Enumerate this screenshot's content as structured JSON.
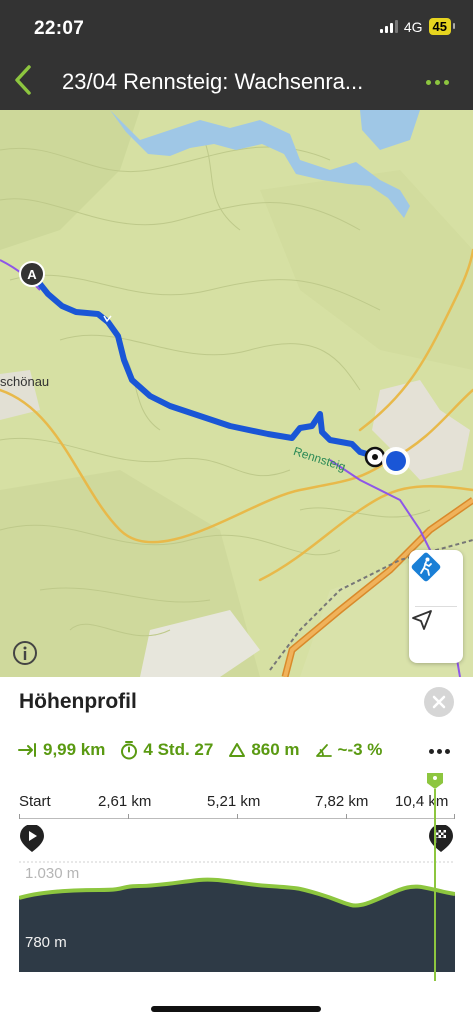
{
  "status_bar": {
    "time": "22:07",
    "network": "4G",
    "battery": "45"
  },
  "header": {
    "title": "23/04 Rennsteig: Wachsenra..."
  },
  "map": {
    "place_label": "schönau",
    "trail_label": "Rennsteig",
    "start_marker": "A",
    "route_color": "#1a56d6",
    "position_color": "#1a56d6"
  },
  "sheet": {
    "title": "Höhenprofil",
    "stats": {
      "distance": "9,99 km",
      "duration": "4 Std. 27",
      "ascent": "860 m",
      "gradient": "~-3 %"
    },
    "distance_axis": [
      "Start",
      "2,61 km",
      "5,21 km",
      "7,82 km",
      "10,4 km"
    ],
    "elevation_labels": {
      "high": "1.030 m",
      "low": "780 m"
    },
    "accent_color": "#5a9a12",
    "marker_color": "#8dc63f"
  },
  "icons": {
    "back": "chevron-left-icon",
    "more": "more-dots-icon",
    "hiking": "hiking-direction-icon",
    "locate": "location-arrow-icon",
    "info": "info-icon",
    "close": "close-icon",
    "start": "play-icon",
    "finish": "finish-flag-icon"
  }
}
